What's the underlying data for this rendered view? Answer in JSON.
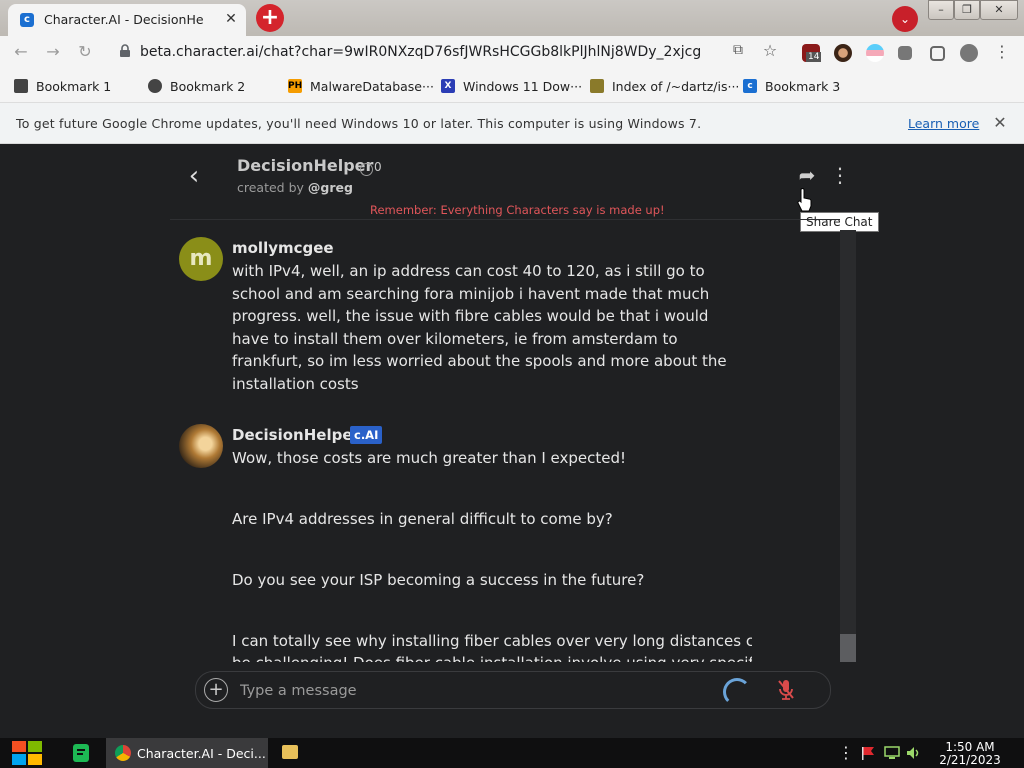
{
  "browser": {
    "tab_title": "Character.AI - DecisionHelper",
    "tab_close": "✕",
    "new_tab": "+",
    "url": "beta.character.ai/chat?char=9wIR0NXzqD76sfJWRsHCGGb8lkPlJhlNj8WDy_2xjcg",
    "ext_badge": "14",
    "bookmarks": [
      {
        "label": "Bookmark 1",
        "icon": "bookmark-icon"
      },
      {
        "label": "Bookmark 2",
        "icon": "globe-icon"
      },
      {
        "label": "MalwareDatabase···",
        "icon": "ph-icon"
      },
      {
        "label": "Windows 11 Dow···",
        "icon": "x-icon"
      },
      {
        "label": "Index of /~dartz/is···",
        "icon": "folder-person-icon"
      },
      {
        "label": "Bookmark 3",
        "icon": "character-ai-icon"
      }
    ],
    "infobar_text": "To get future Google Chrome updates, you'll need Windows 10 or later. This computer is using Windows 7.",
    "learn_more": "Learn more",
    "infobar_close": "✕"
  },
  "chat": {
    "character_name": "DecisionHelper",
    "chat_count": "0",
    "created_by_prefix": "created by ",
    "creator": "@greg",
    "disclaimer": "Remember: Everything Characters say is made up!",
    "tooltip": "Share Chat",
    "messages": [
      {
        "author": "mollymcgee",
        "avatar_letter": "m",
        "text": "with IPv4, well, an ip address can cost 40 to 120, as i still go to school and am searching fora minijob i havent made that much progress. well, the issue with fibre cables would be that i would have to install them over kilometers, ie from amsterdam to frankfurt, so im less worried about the spools and more about the installation costs"
      },
      {
        "author": "DecisionHelper",
        "badge": "c.AI",
        "paragraphs": [
          "Wow, those costs are much greater than I expected!",
          "Are IPv4 addresses in general difficult to come by?",
          "Do you see your ISP becoming a success in the future?",
          "I can totally see why installing fiber cables over very long distances can",
          "be challenging! Does fiber cable installation involve using very specific"
        ]
      }
    ],
    "input_placeholder": "Type a message"
  },
  "taskbar": {
    "chrome_label": "Character.AI - Deci...",
    "time": "1:50 AM",
    "date": "2/21/2023"
  },
  "colors": {
    "app_bg": "#1f2022",
    "disclaimer": "#e0565a",
    "badge": "#2a61c9",
    "user_avatar": "#8a8e18"
  }
}
